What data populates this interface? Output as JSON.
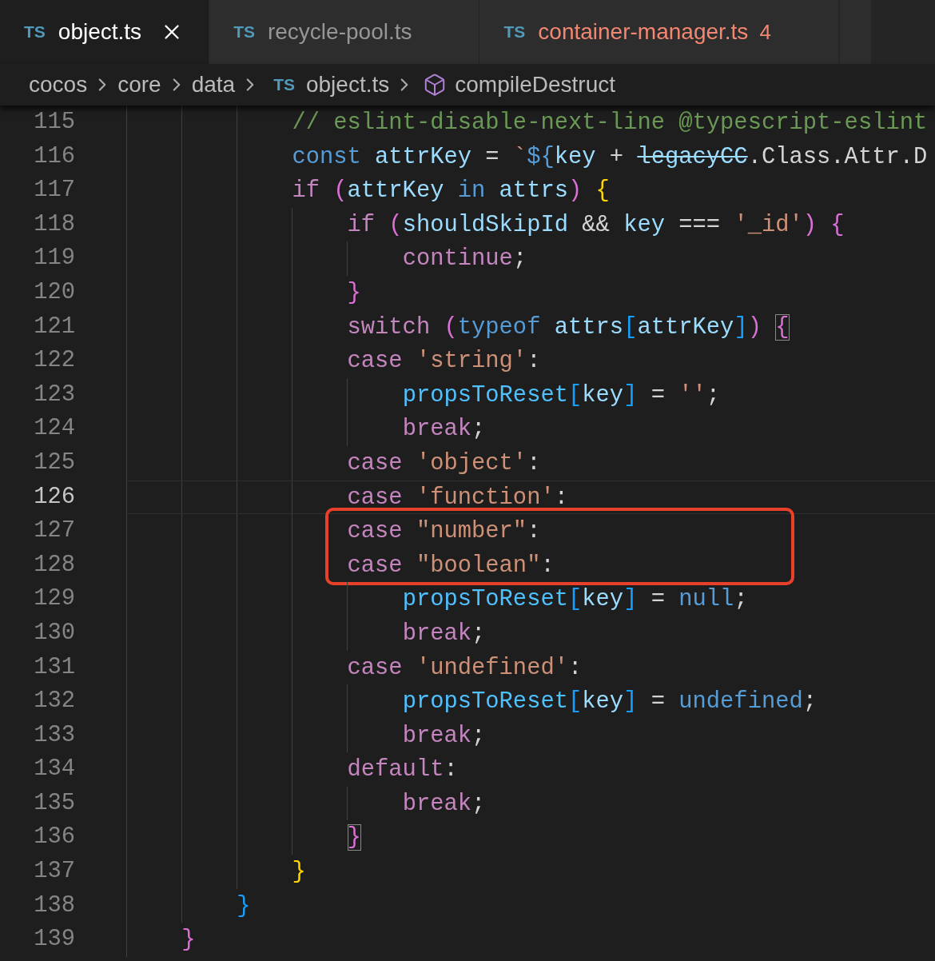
{
  "tabs": [
    {
      "file_icon": "TS",
      "name": "object.ts",
      "selected": true
    },
    {
      "file_icon": "TS",
      "name": "recycle-pool.ts",
      "selected": false
    },
    {
      "file_icon": "TS",
      "name": "container-manager.ts",
      "selected": false,
      "problems": "4"
    }
  ],
  "breadcrumb": [
    {
      "label": "cocos",
      "kind": "folder"
    },
    {
      "label": "core",
      "kind": "folder"
    },
    {
      "label": "data",
      "kind": "folder"
    },
    {
      "label": "object.ts",
      "kind": "file",
      "file_icon": "TS"
    },
    {
      "label": "compileDestruct",
      "kind": "symbol"
    }
  ],
  "lines": [
    {
      "number": "115",
      "current": false,
      "boxed": false,
      "tokens": [
        {
          "text": "            // eslint-disable-next-line @typescript-eslint",
          "kind": "comment"
        }
      ]
    },
    {
      "number": "116",
      "current": false,
      "boxed": false,
      "tokens": [
        {
          "text": "            const ",
          "kind": "storage"
        },
        {
          "text": "attrKey",
          "kind": "var"
        },
        {
          "text": " = ",
          "kind": "plain"
        },
        {
          "text": "`",
          "kind": "string"
        },
        {
          "text": "${",
          "kind": "storage"
        },
        {
          "text": "key",
          "kind": "var"
        },
        {
          "text": " + ",
          "kind": "plain"
        },
        {
          "text": "legacyCC",
          "kind": "deprecated"
        },
        {
          "text": ".Class.Attr.D",
          "kind": "plain"
        }
      ]
    },
    {
      "number": "117",
      "current": false,
      "boxed": false,
      "tokens": [
        {
          "text": "            if ",
          "kind": "control"
        },
        {
          "text": "(",
          "kind": "bracket_orchid"
        },
        {
          "text": "attrKey ",
          "kind": "var"
        },
        {
          "text": "in ",
          "kind": "storage"
        },
        {
          "text": "attrs",
          "kind": "var"
        },
        {
          "text": ") ",
          "kind": "bracket_orchid"
        },
        {
          "text": "{",
          "kind": "bracket_gold"
        }
      ]
    },
    {
      "number": "118",
      "current": false,
      "boxed": false,
      "tokens": [
        {
          "text": "                if ",
          "kind": "control"
        },
        {
          "text": "(",
          "kind": "bracket_orchid"
        },
        {
          "text": "shouldSkipId",
          "kind": "var"
        },
        {
          "text": " && ",
          "kind": "plain"
        },
        {
          "text": "key",
          "kind": "var"
        },
        {
          "text": " === ",
          "kind": "plain"
        },
        {
          "text": "'_id'",
          "kind": "string"
        },
        {
          "text": ") {",
          "kind": "bracket_orchid"
        }
      ]
    },
    {
      "number": "119",
      "current": false,
      "boxed": false,
      "tokens": [
        {
          "text": "                    continue",
          "kind": "control"
        },
        {
          "text": ";",
          "kind": "plain"
        }
      ]
    },
    {
      "number": "120",
      "current": false,
      "boxed": false,
      "tokens": [
        {
          "text": "                }",
          "kind": "bracket_orchid"
        }
      ]
    },
    {
      "number": "121",
      "current": false,
      "boxed": false,
      "tokens": [
        {
          "text": "                switch ",
          "kind": "control"
        },
        {
          "text": "(",
          "kind": "bracket_orchid"
        },
        {
          "text": "typeof ",
          "kind": "storage"
        },
        {
          "text": "attrs",
          "kind": "var"
        },
        {
          "text": "[",
          "kind": "bracket_blue"
        },
        {
          "text": "attrKey",
          "kind": "var"
        },
        {
          "text": "]",
          "kind": "bracket_blue"
        },
        {
          "text": ") ",
          "kind": "bracket_orchid"
        },
        {
          "text": "{",
          "kind": "bracket_orchid",
          "matched": true
        }
      ]
    },
    {
      "number": "122",
      "current": false,
      "boxed": false,
      "tokens": [
        {
          "text": "                case ",
          "kind": "control"
        },
        {
          "text": "'string'",
          "kind": "string"
        },
        {
          "text": ":",
          "kind": "plain"
        }
      ]
    },
    {
      "number": "123",
      "current": false,
      "boxed": false,
      "tokens": [
        {
          "text": "                    propsToReset",
          "kind": "const_var"
        },
        {
          "text": "[",
          "kind": "bracket_blue"
        },
        {
          "text": "key",
          "kind": "var"
        },
        {
          "text": "]",
          "kind": "bracket_blue"
        },
        {
          "text": " = ",
          "kind": "plain"
        },
        {
          "text": "''",
          "kind": "string"
        },
        {
          "text": ";",
          "kind": "plain"
        }
      ]
    },
    {
      "number": "124",
      "current": false,
      "boxed": false,
      "tokens": [
        {
          "text": "                    break",
          "kind": "control"
        },
        {
          "text": ";",
          "kind": "plain"
        }
      ]
    },
    {
      "number": "125",
      "current": false,
      "boxed": false,
      "tokens": [
        {
          "text": "                case ",
          "kind": "control"
        },
        {
          "text": "'object'",
          "kind": "string"
        },
        {
          "text": ":",
          "kind": "plain"
        }
      ]
    },
    {
      "number": "126",
      "current": true,
      "boxed": false,
      "tokens": [
        {
          "text": "                case ",
          "kind": "control"
        },
        {
          "text": "'function'",
          "kind": "string"
        },
        {
          "text": ":",
          "kind": "plain"
        }
      ]
    },
    {
      "number": "127",
      "current": false,
      "boxed": true,
      "tokens": [
        {
          "text": "                case ",
          "kind": "control"
        },
        {
          "text": "\"number\"",
          "kind": "string"
        },
        {
          "text": ":",
          "kind": "plain"
        }
      ]
    },
    {
      "number": "128",
      "current": false,
      "boxed": true,
      "tokens": [
        {
          "text": "                case ",
          "kind": "control"
        },
        {
          "text": "\"boolean\"",
          "kind": "string"
        },
        {
          "text": ":",
          "kind": "plain"
        }
      ]
    },
    {
      "number": "129",
      "current": false,
      "boxed": false,
      "tokens": [
        {
          "text": "                    propsToReset",
          "kind": "const_var"
        },
        {
          "text": "[",
          "kind": "bracket_blue"
        },
        {
          "text": "key",
          "kind": "var"
        },
        {
          "text": "]",
          "kind": "bracket_blue"
        },
        {
          "text": " = ",
          "kind": "plain"
        },
        {
          "text": "null",
          "kind": "storage"
        },
        {
          "text": ";",
          "kind": "plain"
        }
      ]
    },
    {
      "number": "130",
      "current": false,
      "boxed": false,
      "tokens": [
        {
          "text": "                    break",
          "kind": "control"
        },
        {
          "text": ";",
          "kind": "plain"
        }
      ]
    },
    {
      "number": "131",
      "current": false,
      "boxed": false,
      "tokens": [
        {
          "text": "                case ",
          "kind": "control"
        },
        {
          "text": "'undefined'",
          "kind": "string"
        },
        {
          "text": ":",
          "kind": "plain"
        }
      ]
    },
    {
      "number": "132",
      "current": false,
      "boxed": false,
      "tokens": [
        {
          "text": "                    propsToReset",
          "kind": "const_var"
        },
        {
          "text": "[",
          "kind": "bracket_blue"
        },
        {
          "text": "key",
          "kind": "var"
        },
        {
          "text": "]",
          "kind": "bracket_blue"
        },
        {
          "text": " = ",
          "kind": "plain"
        },
        {
          "text": "undefined",
          "kind": "storage"
        },
        {
          "text": ";",
          "kind": "plain"
        }
      ]
    },
    {
      "number": "133",
      "current": false,
      "boxed": false,
      "tokens": [
        {
          "text": "                    break",
          "kind": "control"
        },
        {
          "text": ";",
          "kind": "plain"
        }
      ]
    },
    {
      "number": "134",
      "current": false,
      "boxed": false,
      "tokens": [
        {
          "text": "                default",
          "kind": "control"
        },
        {
          "text": ":",
          "kind": "plain"
        }
      ]
    },
    {
      "number": "135",
      "current": false,
      "boxed": false,
      "tokens": [
        {
          "text": "                    break",
          "kind": "control"
        },
        {
          "text": ";",
          "kind": "plain"
        }
      ]
    },
    {
      "number": "136",
      "current": false,
      "boxed": false,
      "tokens": [
        {
          "text": "                }",
          "kind": "bracket_orchid",
          "matched": true
        }
      ]
    },
    {
      "number": "137",
      "current": false,
      "boxed": false,
      "tokens": [
        {
          "text": "            }",
          "kind": "bracket_gold"
        }
      ]
    },
    {
      "number": "138",
      "current": false,
      "boxed": false,
      "tokens": [
        {
          "text": "        }",
          "kind": "bracket_blue"
        }
      ]
    },
    {
      "number": "139",
      "current": false,
      "boxed": false,
      "tokens": [
        {
          "text": "    }",
          "kind": "bracket_orchid"
        }
      ]
    }
  ]
}
